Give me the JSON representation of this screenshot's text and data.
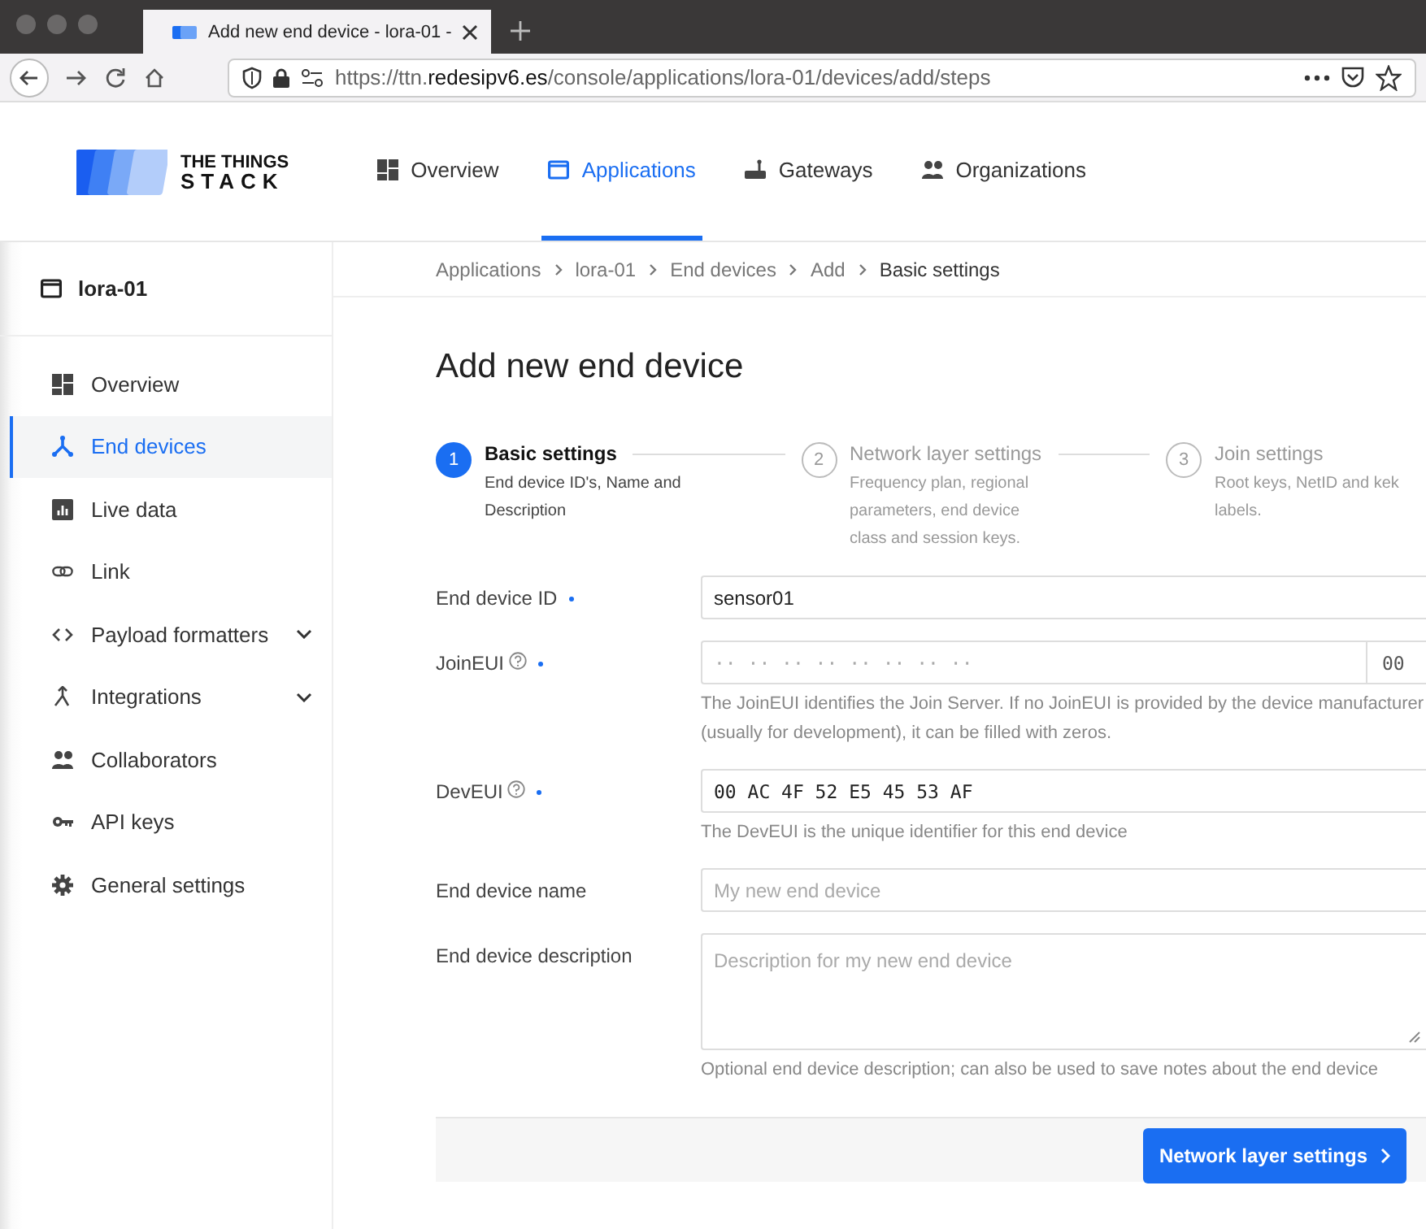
{
  "browser": {
    "tab_title": "Add new end device - lora-01 -",
    "url": "https://ttn.**redesipv6.es**/console/applications/lora-01/devices/add/steps"
  },
  "header": {
    "logo_top": "THE THINGS",
    "logo_bottom": "STACK",
    "nav": [
      {
        "label": "Overview",
        "selected": false
      },
      {
        "label": "Applications",
        "selected": true
      },
      {
        "label": "Gateways",
        "selected": false
      },
      {
        "label": "Organizations",
        "selected": false
      }
    ]
  },
  "sidebar": {
    "application": "lora-01",
    "items": [
      {
        "label": "Overview",
        "selected": false,
        "has_submenu": false
      },
      {
        "label": "End devices",
        "selected": true,
        "has_submenu": false
      },
      {
        "label": "Live data",
        "selected": false,
        "has_submenu": false
      },
      {
        "label": "Link",
        "selected": false,
        "has_submenu": false
      },
      {
        "label": "Payload formatters",
        "selected": false,
        "has_submenu": true
      },
      {
        "label": "Integrations",
        "selected": false,
        "has_submenu": true
      },
      {
        "label": "Collaborators",
        "selected": false,
        "has_submenu": false
      },
      {
        "label": "API keys",
        "selected": false,
        "has_submenu": false
      },
      {
        "label": "General settings",
        "selected": false,
        "has_submenu": false
      }
    ]
  },
  "breadcrumb": [
    {
      "label": "Applications",
      "current": false
    },
    {
      "label": "lora-01",
      "current": false
    },
    {
      "label": "End devices",
      "current": false
    },
    {
      "label": "Add",
      "current": false
    },
    {
      "label": "Basic settings",
      "current": true
    }
  ],
  "title": "Add new end device",
  "steps": [
    {
      "number": "1",
      "title": "Basic settings",
      "description": "End device ID's, Name and Description",
      "active": true
    },
    {
      "number": "2",
      "title": "Network layer settings",
      "description": "Frequency plan, regional parameters, end device class and session keys.",
      "active": false
    },
    {
      "number": "3",
      "title": "Join settings",
      "description": "Root keys, NetID and kek labels.",
      "active": false
    }
  ],
  "fields": [
    {
      "kind": "text",
      "label": "End device ID",
      "required": true,
      "help": false,
      "value": "sensor01"
    },
    {
      "kind": "eui",
      "label": "JoinEUI",
      "required": true,
      "help": true,
      "placeholder": "·· ·· ·· ·· ·· ·· ·· ··",
      "suffix": "00",
      "hint": "The JoinEUI identifies the Join Server. If no JoinEUI is provided by the device manufacturer (usually for development), it can be filled with zeros."
    },
    {
      "kind": "eui",
      "label": "DevEUI",
      "required": true,
      "help": true,
      "value": "00 AC 4F 52 E5 45 53 AF",
      "hint": "The DevEUI is the unique identifier for this end device"
    },
    {
      "kind": "text",
      "label": "End device name",
      "required": false,
      "help": false,
      "placeholder": "My new end device"
    },
    {
      "kind": "textarea",
      "label": "End device description",
      "required": false,
      "help": false,
      "placeholder": "Description for my new end device",
      "hint": "Optional end device description; can also be used to save notes about the end device"
    }
  ],
  "submit": "Network layer settings"
}
